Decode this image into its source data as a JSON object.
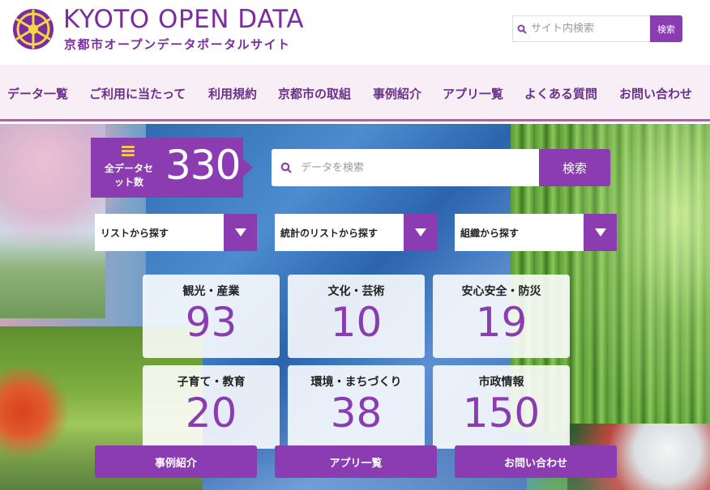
{
  "header": {
    "title": "KYOTO OPEN DATA",
    "subtitle": "京都市オープンデータポータルサイト",
    "logo_icon": "kyoto-city-emblem",
    "site_search": {
      "placeholder": "サイト内検索",
      "button": "検索",
      "icon": "search-icon"
    }
  },
  "nav": {
    "items": [
      {
        "label": "データ一覧"
      },
      {
        "label": "ご利用に当たって"
      },
      {
        "label": "利用規約"
      },
      {
        "label": "京都市の取組"
      },
      {
        "label": "事例紹介"
      },
      {
        "label": "アプリ一覧"
      },
      {
        "label": "よくある質問"
      },
      {
        "label": "お問い合わせ"
      }
    ]
  },
  "hero": {
    "count": {
      "label": "全データセット数",
      "value": "330",
      "icon": "list-icon"
    },
    "data_search": {
      "placeholder": "データを検索",
      "button": "検索",
      "icon": "search-icon"
    },
    "dropdowns": [
      {
        "label": "リストから探す"
      },
      {
        "label": "統計のリストから探す"
      },
      {
        "label": "組織から探す"
      }
    ],
    "categories": [
      {
        "label": "観光・産業",
        "count": "93"
      },
      {
        "label": "文化・芸術",
        "count": "10"
      },
      {
        "label": "安心安全・防災",
        "count": "19"
      },
      {
        "label": "子育て・教育",
        "count": "20"
      },
      {
        "label": "環境・まちづくり",
        "count": "38"
      },
      {
        "label": "市政情報",
        "count": "150"
      }
    ],
    "bottom_buttons": [
      {
        "label": "事例紹介"
      },
      {
        "label": "アプリ一覧"
      },
      {
        "label": "お問い合わせ"
      }
    ]
  },
  "colors": {
    "accent": "#8a3cb0",
    "nav_text": "#6b2f8b",
    "nav_bg": "#f7eef6",
    "icon_yellow": "#f5c84a"
  }
}
